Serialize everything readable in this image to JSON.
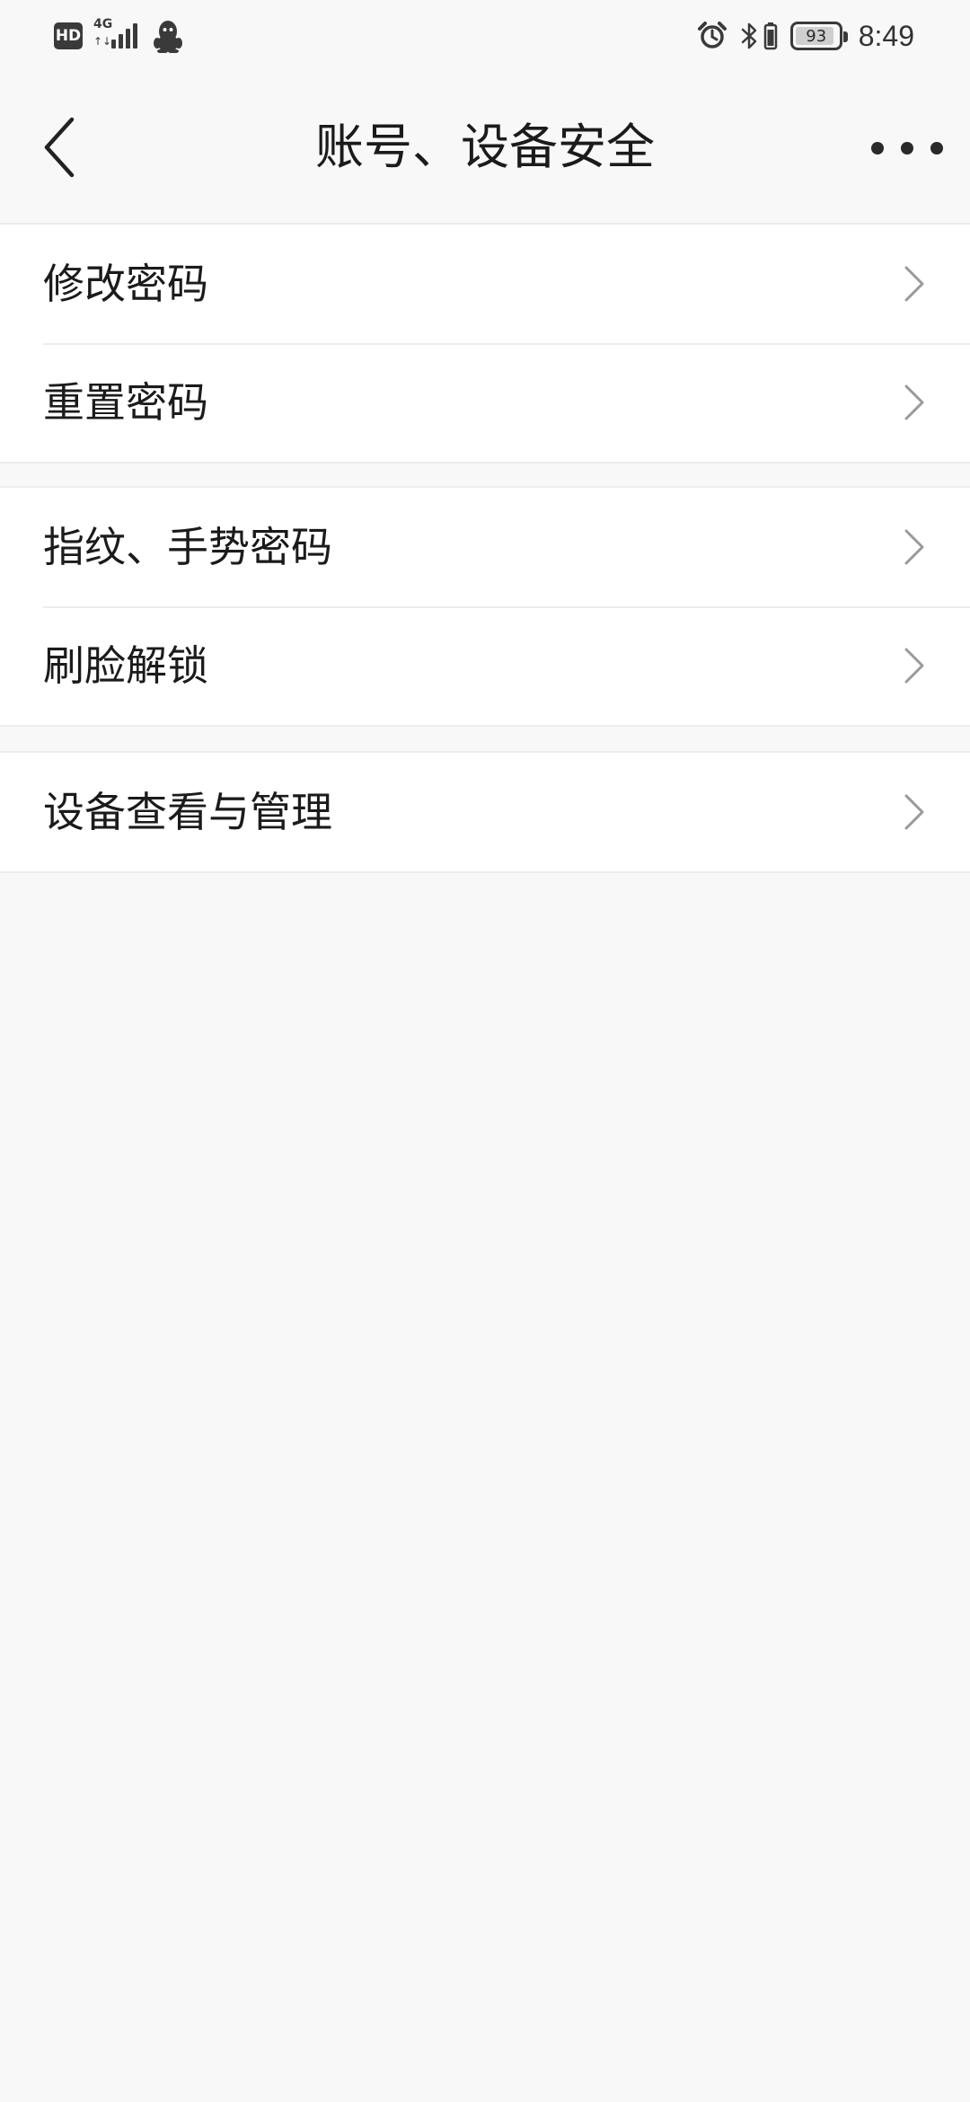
{
  "status_bar": {
    "hd_label": "HD",
    "network_type": "4G",
    "network_arrows": "↑↓",
    "battery_level": "93",
    "battery_fraction": 0.93,
    "time": "8:49"
  },
  "header": {
    "title": "账号、设备安全"
  },
  "groups": [
    {
      "items": [
        {
          "label": "修改密码"
        },
        {
          "label": "重置密码"
        }
      ]
    },
    {
      "items": [
        {
          "label": "指纹、手势密码"
        },
        {
          "label": "刷脸解锁"
        }
      ]
    },
    {
      "items": [
        {
          "label": "设备查看与管理"
        }
      ]
    }
  ],
  "colors": {
    "background": "#f8f8f8",
    "card": "#ffffff",
    "divider": "#ececec",
    "text": "#1b1b1b",
    "chevron": "#9a9a9a"
  }
}
